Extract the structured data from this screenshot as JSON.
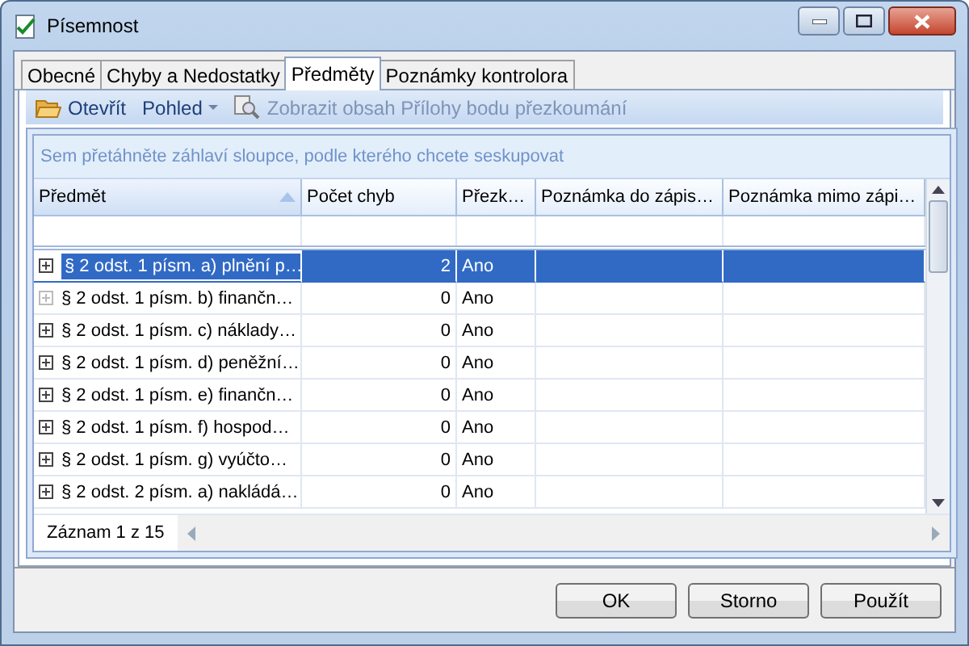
{
  "window": {
    "title": "Písemnost"
  },
  "tabs": [
    {
      "label": "Obecné",
      "selected": false
    },
    {
      "label": "Chyby a Nedostatky",
      "selected": false
    },
    {
      "label": "Předměty",
      "selected": true
    },
    {
      "label": "Poznámky kontrolora",
      "selected": false
    }
  ],
  "toolbar": [
    {
      "kind": "open",
      "label": "Otevřít",
      "disabled": false
    },
    {
      "kind": "dropdown",
      "label": "Pohled",
      "disabled": false
    },
    {
      "kind": "preview",
      "label": "Zobrazit obsah Přílohy bodu přezkoumání",
      "disabled": true
    }
  ],
  "group_panel": {
    "hint": "Sem přetáhněte záhlaví sloupce, podle kterého chcete seskupovat"
  },
  "table": {
    "columns": [
      {
        "label": "Předmět",
        "sorted": true
      },
      {
        "label": "Počet chyb",
        "sorted": false
      },
      {
        "label": "Přezk…",
        "sorted": false
      },
      {
        "label": "Poznámka do zápis…",
        "sorted": false
      },
      {
        "label": "Poznámka mimo zápi…",
        "sorted": false
      }
    ],
    "rows": [
      {
        "cells": [
          "§ 2 odst. 1 písm. a) plnění p…",
          "2",
          "Ano",
          "",
          ""
        ],
        "selected": true,
        "expander_disabled": false
      },
      {
        "cells": [
          "§ 2 odst. 1 písm. b) finančn…",
          "0",
          "Ano",
          "",
          ""
        ],
        "selected": false,
        "expander_disabled": true
      },
      {
        "cells": [
          "§ 2 odst. 1 písm. c) náklady…",
          "0",
          "Ano",
          "",
          ""
        ],
        "selected": false,
        "expander_disabled": false
      },
      {
        "cells": [
          "§ 2 odst. 1 písm. d) peněžní…",
          "0",
          "Ano",
          "",
          ""
        ],
        "selected": false,
        "expander_disabled": false
      },
      {
        "cells": [
          "§ 2 odst. 1 písm. e) finančn…",
          "0",
          "Ano",
          "",
          ""
        ],
        "selected": false,
        "expander_disabled": false
      },
      {
        "cells": [
          "§ 2 odst. 1 písm. f) hospod…",
          "0",
          "Ano",
          "",
          ""
        ],
        "selected": false,
        "expander_disabled": false
      },
      {
        "cells": [
          "§ 2 odst. 1 písm. g) vyúčto…",
          "0",
          "Ano",
          "",
          ""
        ],
        "selected": false,
        "expander_disabled": false
      },
      {
        "cells": [
          "§ 2 odst. 2 písm. a) nakládá…",
          "0",
          "Ano",
          "",
          ""
        ],
        "selected": false,
        "expander_disabled": false
      }
    ],
    "record_count": "Záznam 1 z 15"
  },
  "buttons": [
    "OK",
    "Storno",
    "Použít"
  ]
}
